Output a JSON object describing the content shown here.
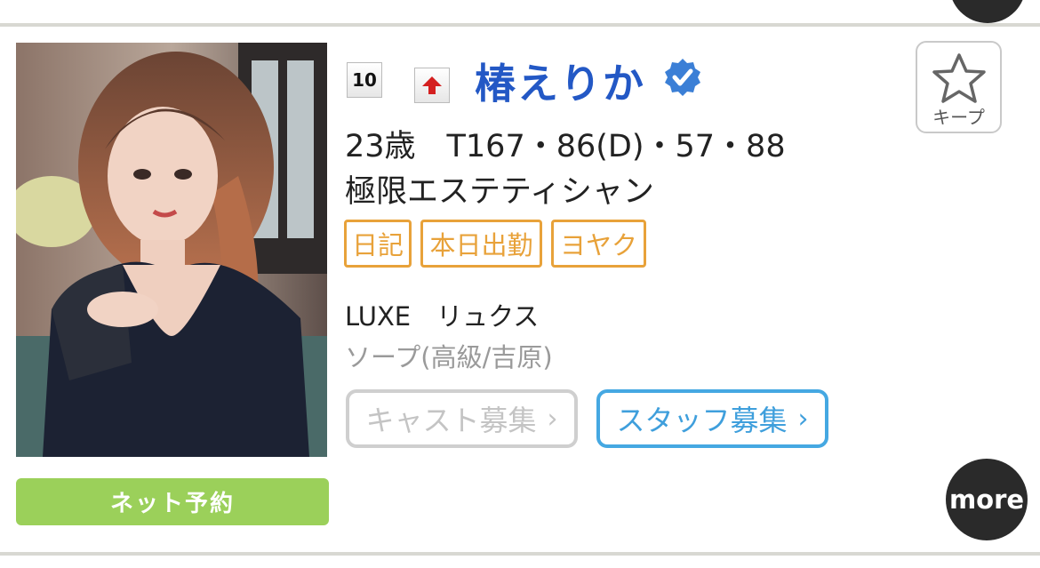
{
  "card": {
    "rank": "10",
    "name": "椿えりか",
    "stats": "23歳　T167・86(D)・57・88",
    "catchphrase": "極限エステティシャン",
    "tags": [
      "日記",
      "本日出勤",
      "ヨヤク"
    ],
    "shop_name": "LUXE　リュクス",
    "shop_genre": "ソープ(高級/吉原)",
    "recruit_cast_label": "キャスト募集",
    "recruit_staff_label": "スタッフ募集",
    "chevron": "›",
    "keep_label": "キープ",
    "reserve_label": "ネット予約",
    "more_label": "more"
  },
  "icons": {
    "rank": "rank-badge",
    "trend": "up-arrow-icon",
    "verified": "verified-check-icon",
    "keep": "star-icon"
  },
  "colors": {
    "name": "#2358c5",
    "verified": "#3b7fd6",
    "tag_border": "#e8a23a",
    "reserve_bg": "#9bd05a",
    "staff_border": "#45a8e2",
    "cast_border": "#cfcfcf",
    "more_bg": "#2a2a2a",
    "divider": "#d8d8d2"
  }
}
